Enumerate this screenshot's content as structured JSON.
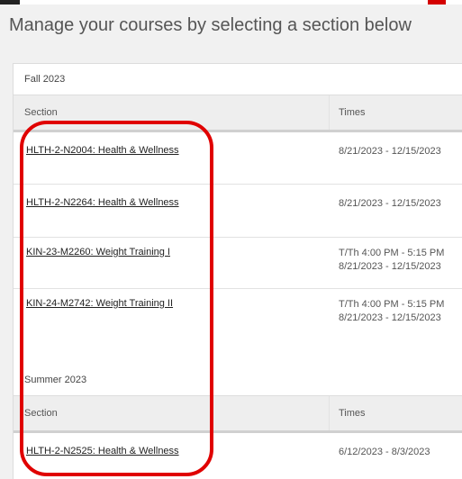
{
  "page": {
    "title": "Manage your courses by selecting a section below"
  },
  "terms": [
    {
      "name": "Fall 2023",
      "headers": {
        "section": "Section",
        "times": "Times"
      },
      "rows": [
        {
          "section": "HLTH-2-N2004: Health & Wellness",
          "time_line1": "8/21/2023 - 12/15/2023",
          "time_line2": ""
        },
        {
          "section": "HLTH-2-N2264: Health & Wellness",
          "time_line1": "8/21/2023 - 12/15/2023",
          "time_line2": ""
        },
        {
          "section": "KIN-23-M2260: Weight Training I",
          "time_line1": "T/Th 4:00 PM - 5:15 PM",
          "time_line2": "8/21/2023 - 12/15/2023"
        },
        {
          "section": "KIN-24-M2742: Weight Training II",
          "time_line1": "T/Th 4:00 PM - 5:15 PM",
          "time_line2": "8/21/2023 - 12/15/2023"
        }
      ]
    },
    {
      "name": "Summer 2023",
      "headers": {
        "section": "Section",
        "times": "Times"
      },
      "rows": [
        {
          "section": "HLTH-2-N2525: Health & Wellness",
          "time_line1": "6/12/2023 - 8/3/2023",
          "time_line2": ""
        }
      ]
    }
  ],
  "colors": {
    "highlight": "#e00000",
    "background": "#f1f1f1",
    "header_row": "#eeeeee"
  }
}
